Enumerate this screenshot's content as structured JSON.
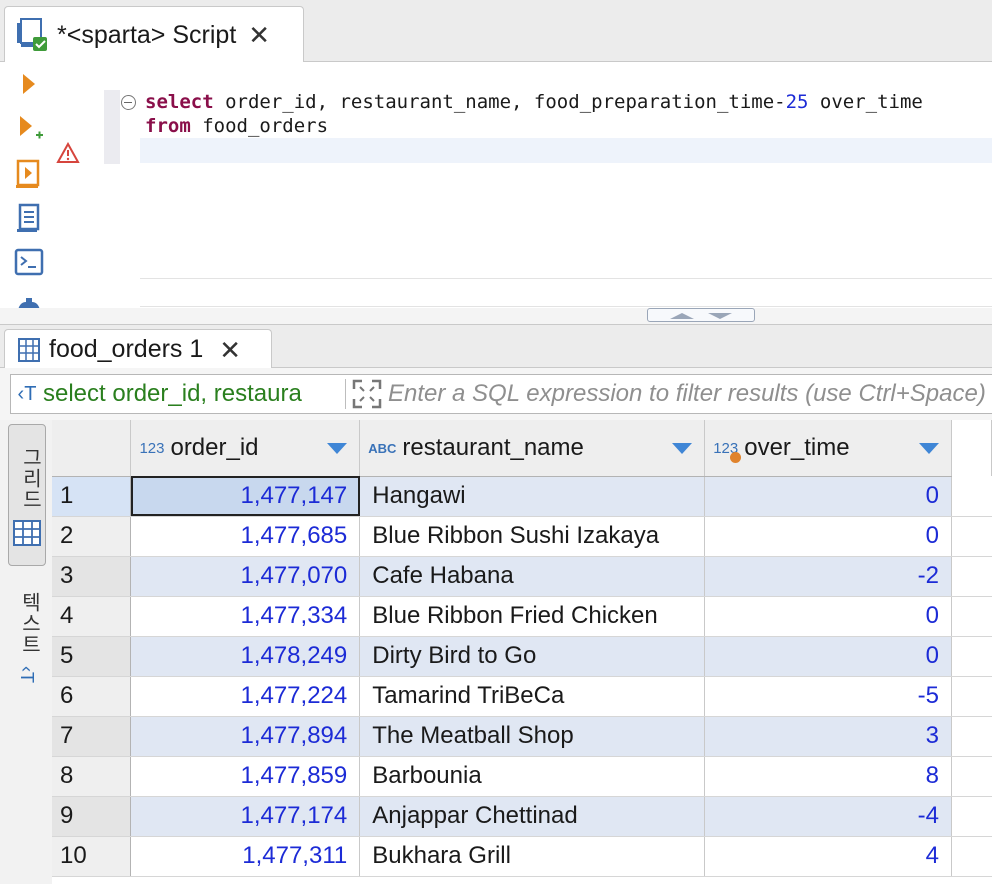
{
  "editor_tab": {
    "title": "*<sparta> Script",
    "close": "✕"
  },
  "query": {
    "line1": {
      "kw": "select",
      "text": " order_id, restaurant_name, food_preparation_time-",
      "num": "25",
      "rest": " over_time"
    },
    "line2": {
      "kw": "from",
      "text": " food_orders"
    }
  },
  "results_tab": {
    "title": "food_orders 1",
    "close": "✕"
  },
  "filter": {
    "sql_preview": "select order_id, restaura",
    "placeholder": "Enter a SQL expression to filter results (use Ctrl+Space)"
  },
  "side_panel": {
    "grid_label": "그리드",
    "text_label": "텍스트"
  },
  "columns": [
    {
      "type": "123",
      "name": "order_id"
    },
    {
      "type": "ABC",
      "name": "restaurant_name"
    },
    {
      "type": "123",
      "name": "over_time"
    }
  ],
  "rows": [
    {
      "n": "1",
      "order_id": "1,477,147",
      "restaurant_name": "Hangawi",
      "over_time": "0"
    },
    {
      "n": "2",
      "order_id": "1,477,685",
      "restaurant_name": "Blue Ribbon Sushi Izakaya",
      "over_time": "0"
    },
    {
      "n": "3",
      "order_id": "1,477,070",
      "restaurant_name": "Cafe Habana",
      "over_time": "-2"
    },
    {
      "n": "4",
      "order_id": "1,477,334",
      "restaurant_name": "Blue Ribbon Fried Chicken",
      "over_time": "0"
    },
    {
      "n": "5",
      "order_id": "1,478,249",
      "restaurant_name": "Dirty Bird to Go",
      "over_time": "0"
    },
    {
      "n": "6",
      "order_id": "1,477,224",
      "restaurant_name": "Tamarind TriBeCa",
      "over_time": "-5"
    },
    {
      "n": "7",
      "order_id": "1,477,894",
      "restaurant_name": "The Meatball Shop",
      "over_time": "3"
    },
    {
      "n": "8",
      "order_id": "1,477,859",
      "restaurant_name": "Barbounia",
      "over_time": "8"
    },
    {
      "n": "9",
      "order_id": "1,477,174",
      "restaurant_name": "Anjappar Chettinad",
      "over_time": "-4"
    },
    {
      "n": "10",
      "order_id": "1,477,311",
      "restaurant_name": "Bukhara Grill",
      "over_time": "4"
    }
  ],
  "colors": {
    "keyword": "#8a0f4a",
    "number": "#1c2bd6",
    "accent": "#3f86d6",
    "row_alt": "#e0e7f3",
    "selection": "#c8d8ee"
  },
  "icons": [
    "script-file-icon",
    "execute-icon",
    "execute-new-tab-icon",
    "execute-script-icon",
    "explain-plan-icon",
    "console-icon",
    "settings-icon",
    "warning-icon",
    "grid-table-icon",
    "filter-text-icon",
    "expand-icon"
  ]
}
